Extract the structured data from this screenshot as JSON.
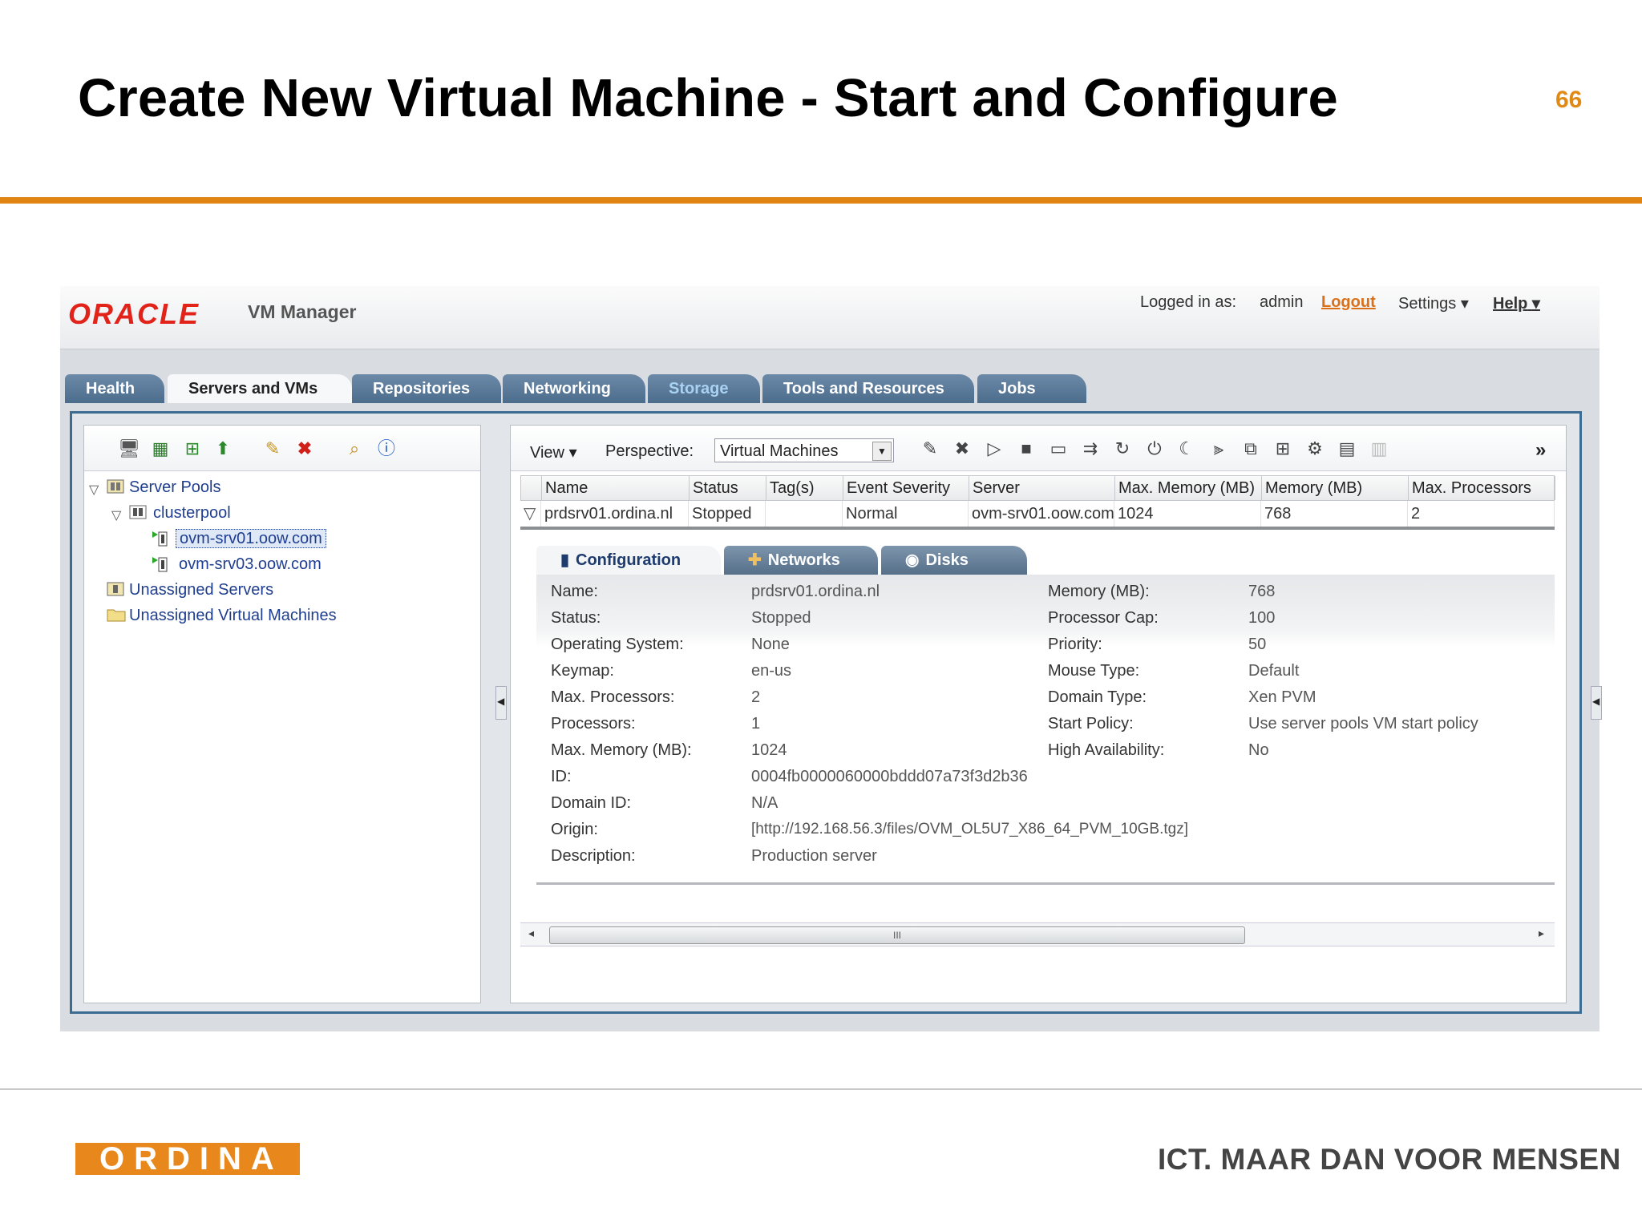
{
  "slide": {
    "title": "Create New Virtual Machine - Start and Configure",
    "number": "66",
    "footer_logo": "ORDINA",
    "footer_tagline": "ICT. MAAR DAN VOOR MENSEN"
  },
  "app": {
    "brand": "ORACLE",
    "product": "VM Manager",
    "logged_in_label": "Logged in as:",
    "user": "admin",
    "logout": "Logout",
    "settings": "Settings",
    "help": "Help",
    "tabs": [
      {
        "label": "Health"
      },
      {
        "label": "Servers and VMs"
      },
      {
        "label": "Repositories"
      },
      {
        "label": "Networking"
      },
      {
        "label": "Storage"
      },
      {
        "label": "Tools and Resources"
      },
      {
        "label": "Jobs"
      }
    ],
    "active_tab": "Servers and VMs"
  },
  "tree": {
    "server_pools": "Server Pools",
    "clusterpool": "clusterpool",
    "server1": "ovm-srv01.oow.com",
    "server2": "ovm-srv03.oow.com",
    "unassigned_servers": "Unassigned Servers",
    "unassigned_vms": "Unassigned Virtual Machines"
  },
  "toolbar": {
    "view": "View",
    "perspective_label": "Perspective:",
    "perspective_value": "Virtual Machines",
    "more": "»"
  },
  "grid": {
    "columns": [
      "Name",
      "Status",
      "Tag(s)",
      "Event Severity",
      "Server",
      "Max. Memory (MB)",
      "Memory (MB)",
      "Max. Processors"
    ],
    "row": {
      "name": "prdsrv01.ordina.nl",
      "status": "Stopped",
      "tags": "",
      "event_severity": "Normal",
      "server": "ovm-srv01.oow.com",
      "max_memory": "1024",
      "memory": "768",
      "max_processors": "2"
    }
  },
  "detail_tabs": [
    "Configuration",
    "Networks",
    "Disks"
  ],
  "config": {
    "left": [
      {
        "label": "Name:",
        "value": "prdsrv01.ordina.nl"
      },
      {
        "label": "Status:",
        "value": "Stopped"
      },
      {
        "label": "Operating System:",
        "value": "None"
      },
      {
        "label": "Keymap:",
        "value": "en-us"
      },
      {
        "label": "Max. Processors:",
        "value": "2"
      },
      {
        "label": "Processors:",
        "value": "1"
      },
      {
        "label": "Max. Memory (MB):",
        "value": "1024"
      },
      {
        "label": "ID:",
        "value": "0004fb0000060000bddd07a73f3d2b36"
      },
      {
        "label": "Domain ID:",
        "value": "N/A"
      },
      {
        "label": "Origin:",
        "value": "[http://192.168.56.3/files/OVM_OL5U7_X86_64_PVM_10GB.tgz]"
      },
      {
        "label": "Description:",
        "value": "Production server"
      }
    ],
    "right": [
      {
        "label": "Memory (MB):",
        "value": "768"
      },
      {
        "label": "Processor Cap:",
        "value": "100"
      },
      {
        "label": "Priority:",
        "value": "50"
      },
      {
        "label": "Mouse Type:",
        "value": "Default"
      },
      {
        "label": "Domain Type:",
        "value": "Xen PVM"
      },
      {
        "label": "Start Policy:",
        "value": "Use server pools VM start policy"
      },
      {
        "label": "High Availability:",
        "value": "No"
      }
    ]
  },
  "scrollbar": {
    "thumb": "III"
  },
  "colors": {
    "accent_orange": "#e08512",
    "oracle_red": "#e2231a",
    "tab_blue": "#4c6c8c",
    "frame_blue": "#3d6c92"
  }
}
